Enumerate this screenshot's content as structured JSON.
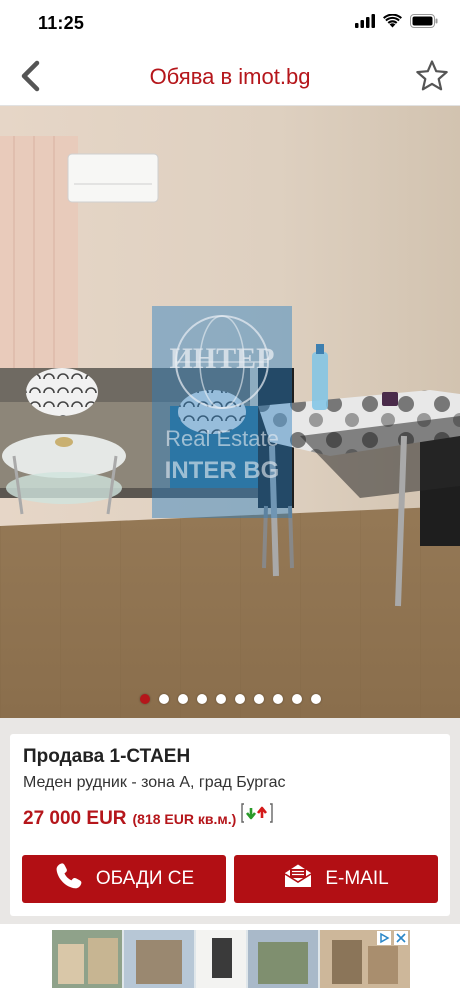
{
  "status_bar": {
    "time": "11:25"
  },
  "nav": {
    "title": "Обява в imot.bg"
  },
  "gallery": {
    "photo_count": 10,
    "active_index": 0
  },
  "listing": {
    "title": "Продава 1-СТАЕН",
    "location": "Меден рудник - зона А, град Бургас",
    "price": "27 000 EUR",
    "price_per_sqm": "(818 EUR кв.м.)"
  },
  "actions": {
    "call_label": "ОБАДИ СЕ",
    "email_label": "E-MAIL"
  },
  "colors": {
    "brand": "#b5161b",
    "button": "#b20f14"
  }
}
